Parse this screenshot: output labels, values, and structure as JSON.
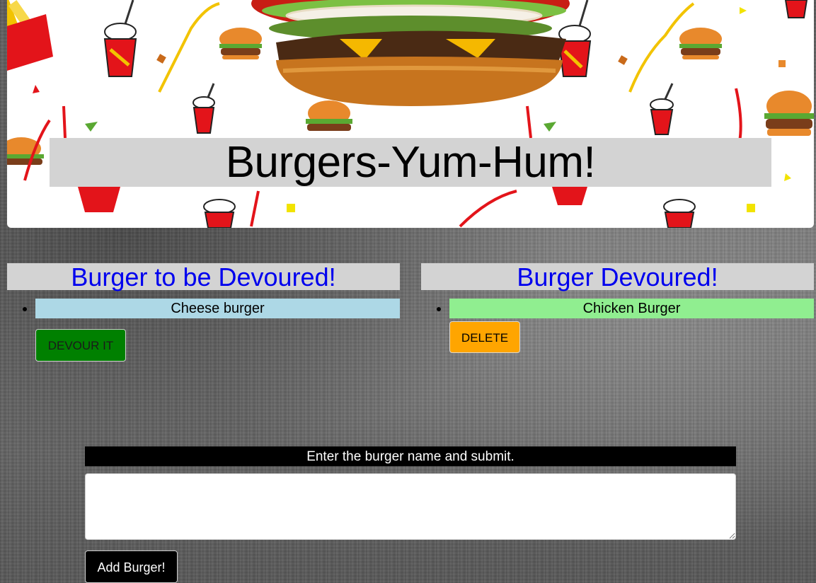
{
  "app": {
    "title": "Burgers-Yum-Hum!"
  },
  "to_devour": {
    "header": "Burger to be Devoured!",
    "items": [
      {
        "name": "Cheese burger",
        "button_label": "DEVOUR IT"
      }
    ]
  },
  "devoured": {
    "header": "Burger Devoured!",
    "items": [
      {
        "name": "Chicken Burger",
        "button_label": "DELETE"
      }
    ]
  },
  "form": {
    "label": "Enter the burger name and submit.",
    "input_value": "",
    "submit_label": "Add Burger!"
  },
  "colors": {
    "header_text": "#0000ee",
    "header_bg": "#d3d3d3",
    "to_devour_item_bg": "#add8e6",
    "devoured_item_bg": "#90ee90",
    "devour_button_bg": "#008000",
    "delete_button_bg": "#ffa500",
    "form_label_bg": "#000000",
    "add_button_bg": "#000000"
  }
}
